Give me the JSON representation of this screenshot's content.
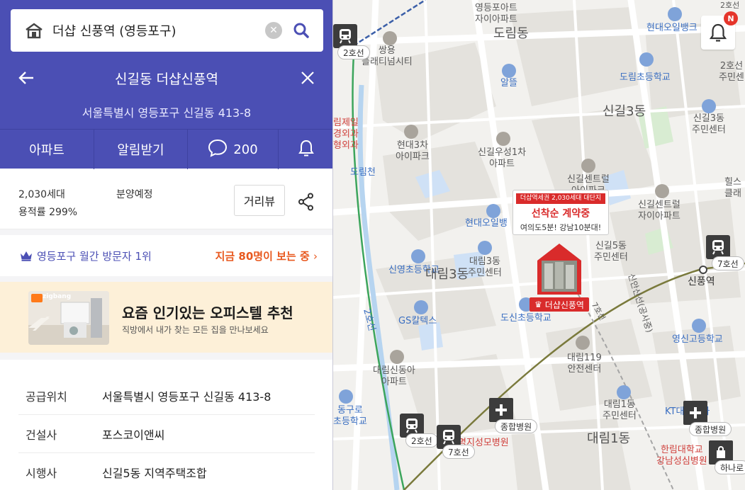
{
  "search": {
    "query": "더샵 신풍역 (영등포구)",
    "colors": {
      "accent": "#4b4fb4"
    }
  },
  "header": {
    "title": "신길동 더샵신풍역",
    "address": "서울특별시 영등포구 신길동 413-8"
  },
  "tabs": [
    {
      "label": "아파트"
    },
    {
      "label": "알림받기"
    },
    {
      "label": "",
      "count": "200",
      "icon": "comment-icon"
    },
    {
      "label": "",
      "icon": "bell-icon"
    }
  ],
  "summary": {
    "units": "2,030세대",
    "far": "용적률 299%",
    "status": "분양예정",
    "review_label": "거리뷰"
  },
  "rank": {
    "text": "영등포구 월간 방문자 1위",
    "hot": "지금 80명이 보는 중"
  },
  "ad": {
    "brand": "zigbang",
    "headline": "요즘 인기있는 오피스텔 추천",
    "sub": "직방에서 내가 찾는 모든 집을 만나보세요"
  },
  "details": [
    {
      "key": "공급위치",
      "value": "서울특별시 영등포구 신길동 413-8"
    },
    {
      "key": "건설사",
      "value": "포스코이앤씨"
    },
    {
      "key": "시행사",
      "value": "신길5동 지역주택조합"
    }
  ],
  "map": {
    "notification_badge": "N",
    "callout": {
      "tag": "더샵역세권 2,030세대 대단지",
      "title": "선착순 계약중",
      "desc": "여의도5분! 강남10분대!"
    },
    "marker_label": "더샵신풍역",
    "labels": {
      "l1": "영등포아트\n자이아파트",
      "l2": "도림동",
      "l3": "쌍용\n플래티넘시티",
      "l4": "알뜰",
      "l5": "현대오일뱅크",
      "l6": "도림초등학교",
      "l7": "2호선\n주민센",
      "l8": "림제일\n경외과\n형외과",
      "l9": "현대3차\n아이파크",
      "l10": "신길우성1차\n아파트",
      "l11": "신길3동",
      "l12": "신길3동\n주민센터",
      "l13": "도림천",
      "l14": "신길센트럴\n아이파크",
      "l15": "신길센트럴\n자이아파트",
      "l16": "힐스\n클래",
      "l17": "현대오일뱅",
      "l18": "대림3동\n주민센터",
      "l19": "신길5동\n주민센터",
      "l20": "신영초등학교",
      "l21": "대림3동",
      "l22": "신풍역",
      "l23": "GS칼텍스",
      "l24": "도신초등학교",
      "l25": "영신고등학교",
      "l26": "2호선",
      "l27": "대림119\n안전센터",
      "l28": "대림신동아\n아파트",
      "l29": "동구로\n초등학교",
      "l30": "대림1동\n주민센터",
      "l31": "KT대림지사",
      "l32": "대림1동",
      "l33": "명지성모병원",
      "l34": "한림대학교\n강남성심병원",
      "l35": "신안산선(공사중)",
      "l36": "7호선",
      "l37": "2호선"
    },
    "chips": {
      "c1": "2호선",
      "c2": "7호선",
      "c3": "2호선",
      "c4": "7호선",
      "c5": "종합병원",
      "c6": "종합병원",
      "c7": "하나로"
    }
  }
}
